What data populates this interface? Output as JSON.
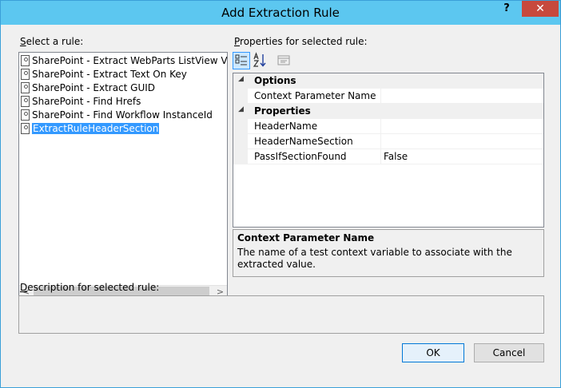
{
  "window": {
    "title": "Add Extraction Rule",
    "help_glyph": "?",
    "close_glyph": "✕"
  },
  "rules": {
    "label_accel": "S",
    "label_rest": "elect a rule:",
    "items": [
      {
        "label": "SharePoint - Extract WebParts ListView Values",
        "selected": false
      },
      {
        "label": "SharePoint - Extract Text On Key",
        "selected": false
      },
      {
        "label": "SharePoint - Extract GUID",
        "selected": false
      },
      {
        "label": "SharePoint - Find Hrefs",
        "selected": false
      },
      {
        "label": "SharePoint - Find Workflow InstanceId",
        "selected": false
      },
      {
        "label": "ExtractRuleHeaderSection",
        "selected": true
      }
    ],
    "scroll_left": "<",
    "scroll_right": ">"
  },
  "properties": {
    "label_accel": "P",
    "label_rest": "roperties for selected rule:",
    "categories": [
      {
        "name": "Options",
        "toggle": "◢",
        "props": [
          {
            "name": "Context Parameter Name",
            "value": ""
          }
        ]
      },
      {
        "name": "Properties",
        "toggle": "◢",
        "props": [
          {
            "name": "HeaderName",
            "value": ""
          },
          {
            "name": "HeaderNameSection",
            "value": ""
          },
          {
            "name": "PassIfSectionFound",
            "value": "False"
          }
        ]
      }
    ],
    "help_title": "Context Parameter Name",
    "help_text": "The name of a test context variable to associate with the extracted value."
  },
  "description": {
    "label_accel": "D",
    "label_rest": "escription for selected rule:",
    "text": ""
  },
  "buttons": {
    "ok": "OK",
    "cancel": "Cancel"
  },
  "colors": {
    "titlebar": "#5cc7f0",
    "close": "#c7493d",
    "selection": "#3399ff"
  }
}
